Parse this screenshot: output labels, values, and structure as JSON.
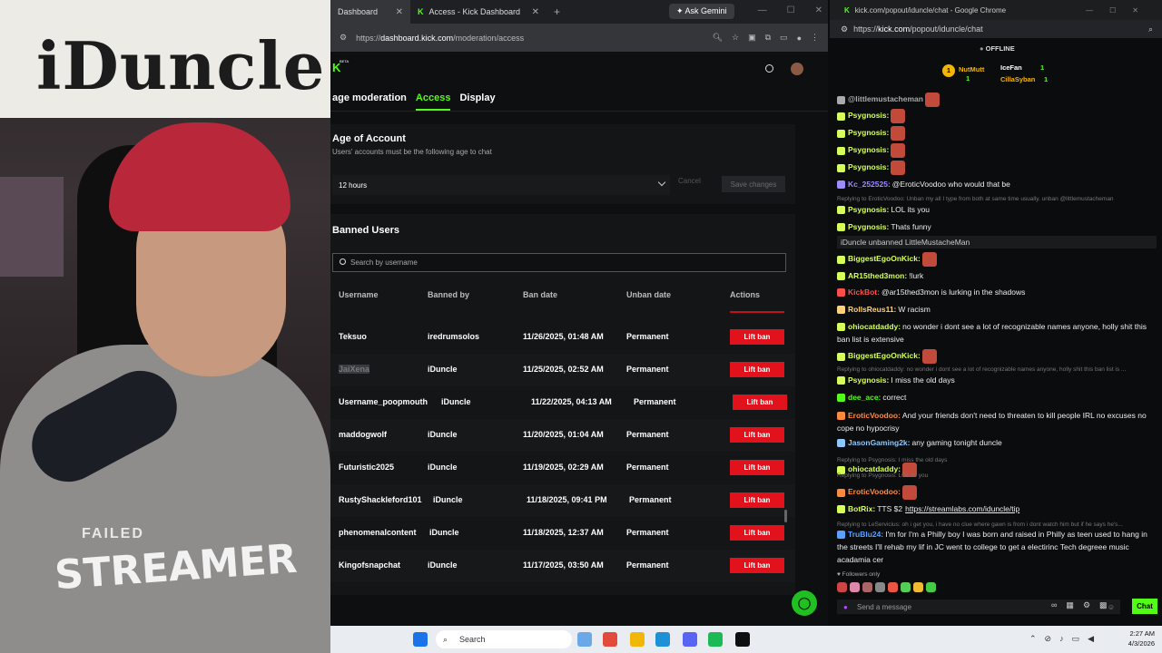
{
  "webcam": {
    "sign_text": "iDuncle",
    "shirt_top": "FAILED",
    "shirt_text": "STREAMER"
  },
  "browser": {
    "tabs": [
      {
        "label": "Dashboard"
      },
      {
        "label": "Access - Kick Dashboard"
      }
    ],
    "gemini_label": "Ask Gemini",
    "url_prefix": "https://",
    "url_host": "dashboard.kick.com",
    "url_path": "/moderation/access",
    "logo_badge": "BETA",
    "subnav": [
      "age moderation",
      "Access",
      "Display"
    ],
    "age_section": {
      "title": "Age of Account",
      "subtitle": "Users' accounts must be the following age to chat",
      "selected": "12 hours",
      "cancel": "Cancel",
      "save": "Save changes"
    },
    "banned": {
      "title": "Banned Users",
      "search_placeholder": "Search by username",
      "columns": [
        "Username",
        "Banned by",
        "Ban date",
        "Unban date",
        "Actions"
      ],
      "rows": [
        {
          "username": "Teksuo",
          "by": "iredrumsolos",
          "date": "11/26/2025, 01:48 AM",
          "unban": "Permanent",
          "action": "Lift ban"
        },
        {
          "username": "JaiXena",
          "by": "iDuncle",
          "date": "11/25/2025, 02:52 AM",
          "unban": "Permanent",
          "action": "Lift ban"
        },
        {
          "username": "Username_poopmouth",
          "by": "iDuncle",
          "date": "11/22/2025, 04:13 AM",
          "unban": "Permanent",
          "action": "Lift ban"
        },
        {
          "username": "maddogwolf",
          "by": "iDuncle",
          "date": "11/20/2025, 01:04 AM",
          "unban": "Permanent",
          "action": "Lift ban"
        },
        {
          "username": "Futuristic2025",
          "by": "iDuncle",
          "date": "11/19/2025, 02:29 AM",
          "unban": "Permanent",
          "action": "Lift ban"
        },
        {
          "username": "RustyShackleford101",
          "by": "iDuncle",
          "date": "11/18/2025, 09:41 PM",
          "unban": "Permanent",
          "action": "Lift ban"
        },
        {
          "username": "phenomenalcontent",
          "by": "iDuncle",
          "date": "11/18/2025, 12:37 AM",
          "unban": "Permanent",
          "action": "Lift ban"
        },
        {
          "username": "Kingofsnapchat",
          "by": "iDuncle",
          "date": "11/17/2025, 03:50 AM",
          "unban": "Permanent",
          "action": "Lift ban"
        }
      ]
    }
  },
  "chat": {
    "window_title": "kick.com/popout/iduncle/chat - Google Chrome",
    "url_prefix": "https://",
    "url_host": "kick.com",
    "url_path": "/popout/iduncle/chat",
    "status": "OFFLINE",
    "leaderboard": [
      {
        "rank": "1",
        "name": "NutMutt",
        "count": "1"
      },
      {
        "rank": "",
        "name": "IceFan",
        "count": "1"
      },
      {
        "rank": "",
        "name": "CillaSyban",
        "count": "1"
      }
    ],
    "messages": [
      {
        "user": "@littlemustacheman",
        "text": "",
        "color": "#aaaaaa"
      },
      {
        "user": "Psygnosis:",
        "text": "",
        "color": "#d7ff5a"
      },
      {
        "user": "Psygnosis:",
        "text": "",
        "color": "#d7ff5a"
      },
      {
        "user": "Psygnosis:",
        "text": "",
        "color": "#d7ff5a"
      },
      {
        "user": "Psygnosis:",
        "text": "",
        "color": "#d7ff5a"
      },
      {
        "user": "Kc_252525:",
        "text": "@EroticVoodoo who would that be",
        "color": "#9b8cff"
      },
      {
        "reply": "Replying to EroticVoodoo: Unban my all I type from both at same time usually. unban @littlemustacheman"
      },
      {
        "user": "Psygnosis:",
        "text": "LOL its you",
        "color": "#d7ff5a"
      },
      {
        "user": "Psygnosis:",
        "text": "Thats funny",
        "color": "#d7ff5a"
      },
      {
        "system": "iDuncle unbanned LittleMustacheMan"
      },
      {
        "user": "BiggestEgoOnKick:",
        "text": "",
        "color": "#d7ff5a"
      },
      {
        "user": "AR15thed3mon:",
        "text": "!lurk",
        "color": "#d7ff5a"
      },
      {
        "user": "KickBot:",
        "text": "@ar15thed3mon is lurking in the shadows",
        "color": "#ff4d4d"
      },
      {
        "user": "RollsReus11:",
        "text": "W racism",
        "color": "#ffd27a"
      },
      {
        "user": "ohiocatdaddy:",
        "text": "no wonder i dont see a lot of recognizable names anyone, holly shit this ban list is extensive",
        "color": "#d7ff5a"
      },
      {
        "user": "BiggestEgoOnKick:",
        "text": "",
        "color": "#d7ff5a"
      },
      {
        "reply": "Replying to ohiocatdaddy: no wonder i dont see a lot of recognizable names anyone, holly shit this ban list is ..."
      },
      {
        "user": "Psygnosis:",
        "text": "I miss the old days",
        "color": "#d7ff5a"
      },
      {
        "user": "dee_ace:",
        "text": "correct",
        "color": "#53fc18"
      },
      {
        "user": "EroticVoodoo:",
        "text": "And your friends don't need to threaten to kill people IRL no excuses no cope no hypocrisy",
        "color": "#ff8a3d"
      },
      {
        "user": "JasonGaming2k:",
        "text": "any gaming tonight duncle",
        "color": "#8cc8ff"
      },
      {
        "reply": "Replying to Psygnosis: I miss the old days"
      },
      {
        "user": "ohiocatdaddy:",
        "text": "",
        "color": "#d7ff5a"
      },
      {
        "reply": "Replying to Psygnosis: LOL its you"
      },
      {
        "user": "EroticVoodoo:",
        "text": "",
        "color": "#ff8a3d"
      },
      {
        "user": "BotRix:",
        "text": "TTS $2",
        "link": "https://streamlabs.com/iduncle/tip",
        "color": "#d7ff5a"
      },
      {
        "reply": "Replying to LeServicius: oh i get you, i have no clue where gawn is from i dont watch him but if he says he's..."
      },
      {
        "user": "TruBlu24:",
        "text": "I'm for I'm a Philly boy I was born and raised in Philly as teen used to hang in the streets I'll rehab my lif in JC went to college to get a electirinc Tech degreee music acadamia cer",
        "color": "#5aa0ff"
      }
    ],
    "followers_only": "Followers only",
    "input_placeholder": "Send a message",
    "send_label": "Chat"
  },
  "taskbar": {
    "search_label": "Search",
    "time": "2:27 AM",
    "date": "4/3/2026"
  }
}
